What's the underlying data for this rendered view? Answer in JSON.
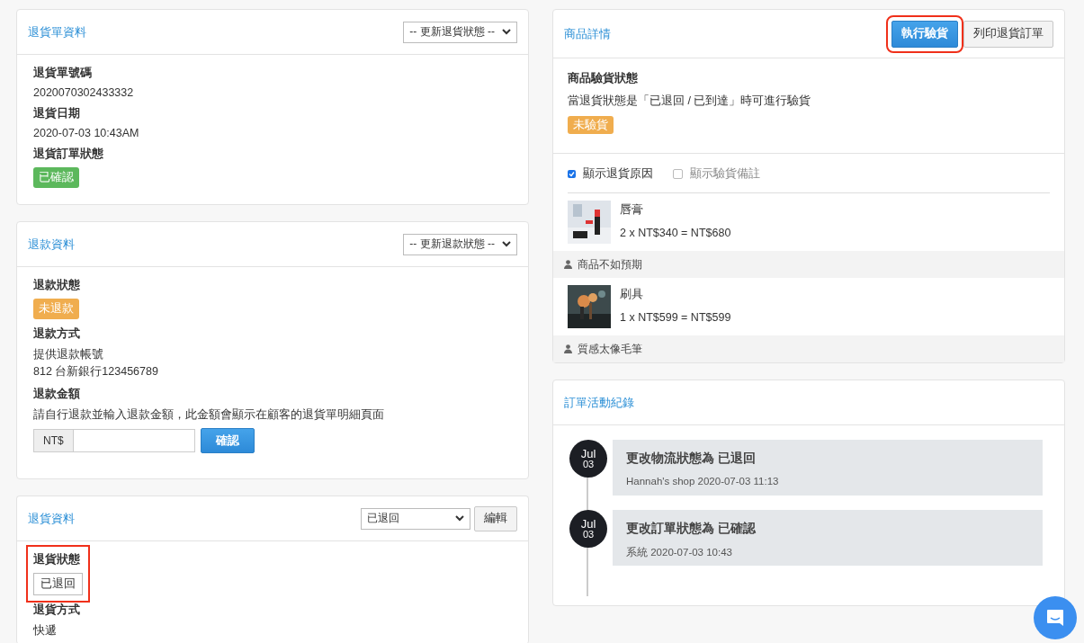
{
  "return_order": {
    "title": "退貨單資料",
    "select": "-- 更新退貨狀態 --",
    "fields": [
      {
        "label": "退貨單號碼",
        "kind": "text",
        "value": "2020070302433332"
      },
      {
        "label": "退貨日期",
        "kind": "text",
        "value": "2020-07-03 10:43AM"
      },
      {
        "label": "退貨訂單狀態",
        "kind": "badge",
        "color": "#5cb85c",
        "value": "已確認"
      }
    ]
  },
  "refund": {
    "title": "退款資料",
    "select": "-- 更新退款狀態 --",
    "fields": [
      {
        "label": "退款狀態",
        "kind": "badge",
        "color": "#f0ad4e",
        "value": "未退款"
      },
      {
        "label": "退款方式",
        "kind": "lines",
        "lines": [
          "提供退款帳號",
          "812 台新銀行123456789"
        ]
      },
      {
        "label": "退款金額",
        "kind": "amount",
        "note": "請自行退款並輸入退款金額，此金額會顯示在顧客的退貨單明細頁面",
        "prefix": "NT$",
        "button": "確認"
      }
    ]
  },
  "return_info": {
    "title": "退貨資料",
    "select": "已退回",
    "button": "編輯",
    "fields": [
      {
        "label": "退貨狀態",
        "kind": "outline",
        "value": "已退回",
        "highlighted": true
      },
      {
        "label": "退貨方式",
        "kind": "text",
        "value": "快遞"
      }
    ]
  },
  "products": {
    "title": "商品詳情",
    "buttons": [
      {
        "label": "執行驗貨",
        "kind": "primary",
        "highlighted": true
      },
      {
        "label": "列印退貨訂單",
        "kind": "default",
        "highlighted": false
      }
    ],
    "inspection": {
      "label": "商品驗貨狀態",
      "note": "當退貨狀態是「已退回 / 已到達」時可進行驗貨",
      "badge": "未驗貨",
      "color": "#f0ad4e"
    },
    "options": [
      {
        "label": "顯示退貨原因",
        "checked": true
      },
      {
        "label": "顯示驗貨備註",
        "checked": false
      }
    ],
    "items": [
      {
        "name": "唇膏",
        "price": "2 x NT$340 = NT$680",
        "reason": "商品不如預期",
        "kind": "picture"
      },
      {
        "name": "刷具",
        "price": "1 x NT$599 = NT$599",
        "reason": "質感太像毛筆",
        "kind": "picture"
      }
    ]
  },
  "activity": {
    "title": "訂單活動紀錄",
    "events": [
      {
        "month": "Jul",
        "day": "03",
        "title": "更改物流狀態為 已退回",
        "meta": "Hannah's shop 2020-07-03 11:13"
      },
      {
        "month": "Jul",
        "day": "03",
        "title": "更改訂單狀態為 已確認",
        "meta": "系統 2020-07-03 10:43"
      }
    ]
  }
}
